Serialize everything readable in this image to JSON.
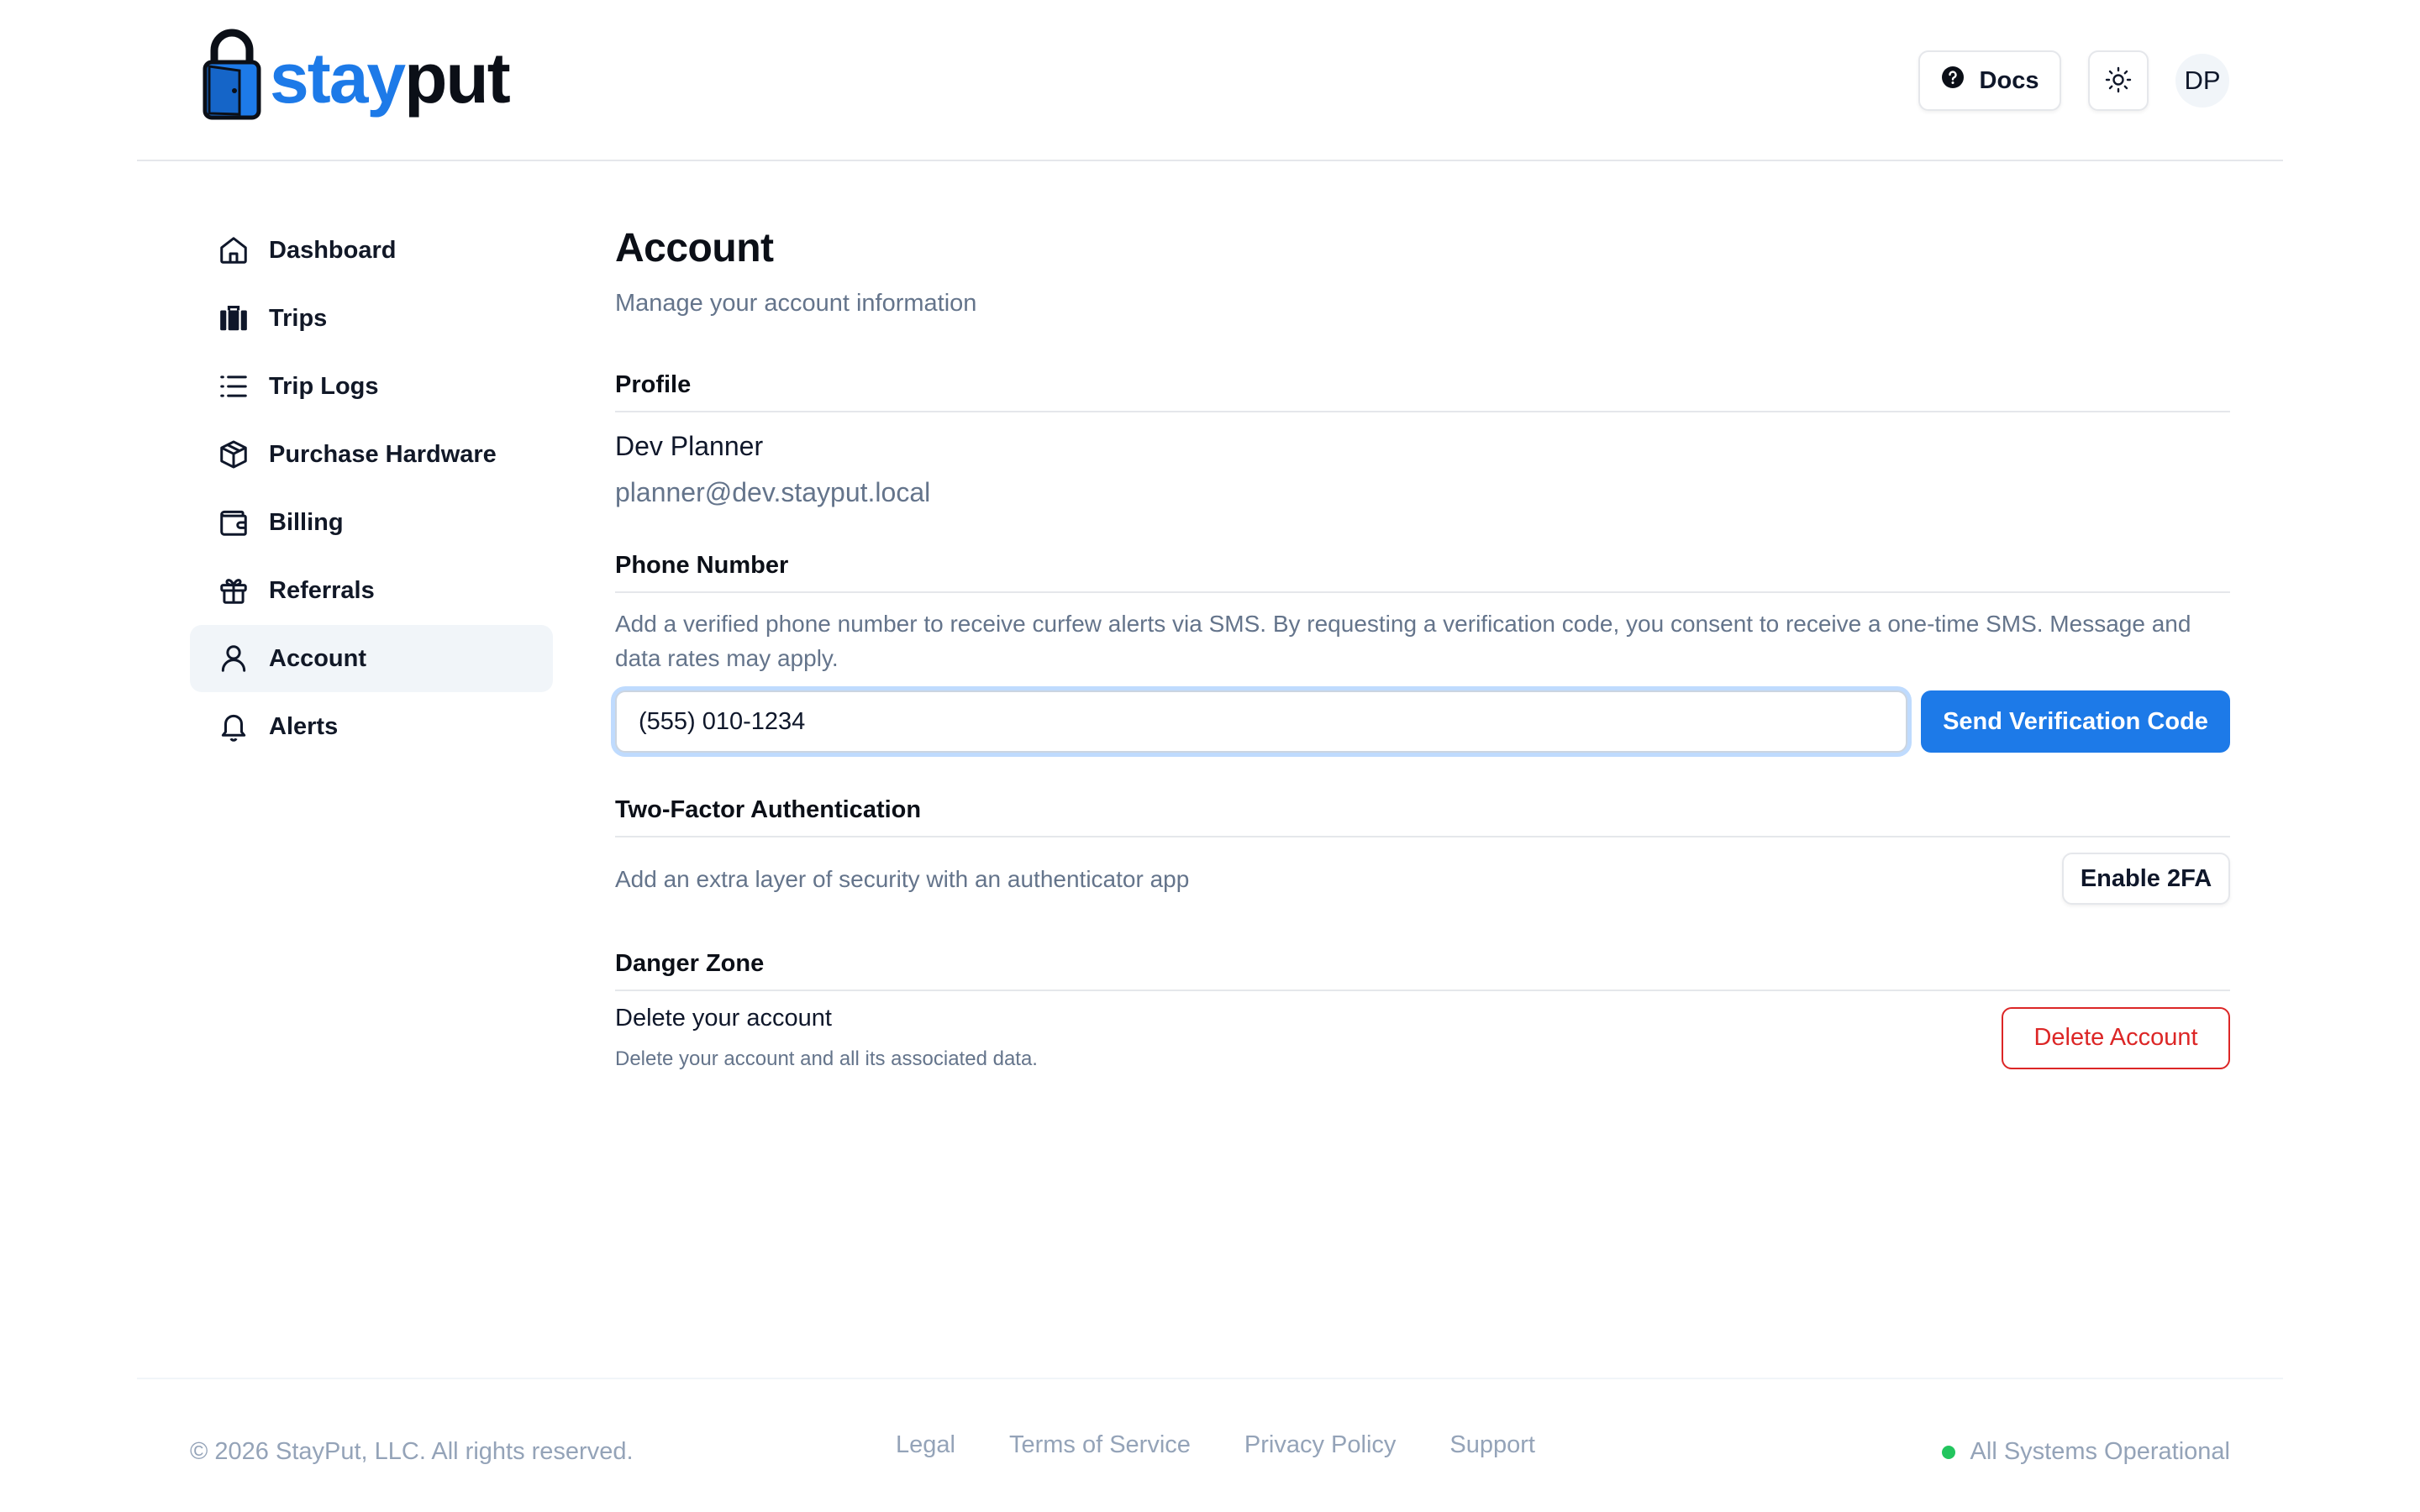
{
  "brand": {
    "part1": "stay",
    "part2": "put",
    "color": "#1d7ae8"
  },
  "header": {
    "docs_label": "Docs",
    "avatar_initials": "DP"
  },
  "sidebar": {
    "items": [
      {
        "label": "Dashboard",
        "icon": "home-icon"
      },
      {
        "label": "Trips",
        "icon": "luggage-icon"
      },
      {
        "label": "Trip Logs",
        "icon": "list-icon"
      },
      {
        "label": "Purchase Hardware",
        "icon": "package-icon"
      },
      {
        "label": "Billing",
        "icon": "wallet-icon"
      },
      {
        "label": "Referrals",
        "icon": "gift-icon"
      },
      {
        "label": "Account",
        "icon": "user-icon",
        "active": true
      },
      {
        "label": "Alerts",
        "icon": "bell-icon"
      }
    ]
  },
  "main": {
    "title": "Account",
    "subtitle": "Manage your account information",
    "profile": {
      "heading": "Profile",
      "name": "Dev Planner",
      "email": "planner@dev.stayput.local"
    },
    "phone": {
      "heading": "Phone Number",
      "description": "Add a verified phone number to receive curfew alerts via SMS. By requesting a verification code, you consent to receive a one-time SMS. Message and data rates may apply.",
      "value": "(555) 010-1234",
      "send_label": "Send Verification Code"
    },
    "twofa": {
      "heading": "Two-Factor Authentication",
      "description": "Add an extra layer of security with an authenticator app",
      "button_label": "Enable 2FA"
    },
    "danger": {
      "heading": "Danger Zone",
      "title": "Delete your account",
      "description": "Delete your account and all its associated data.",
      "button_label": "Delete Account",
      "color": "#dc2626"
    }
  },
  "footer": {
    "copyright": "© 2026 StayPut, LLC. All rights reserved.",
    "links": [
      "Legal",
      "Terms of Service",
      "Privacy Policy",
      "Support"
    ],
    "status": "All Systems Operational",
    "status_color": "#22c55e"
  }
}
